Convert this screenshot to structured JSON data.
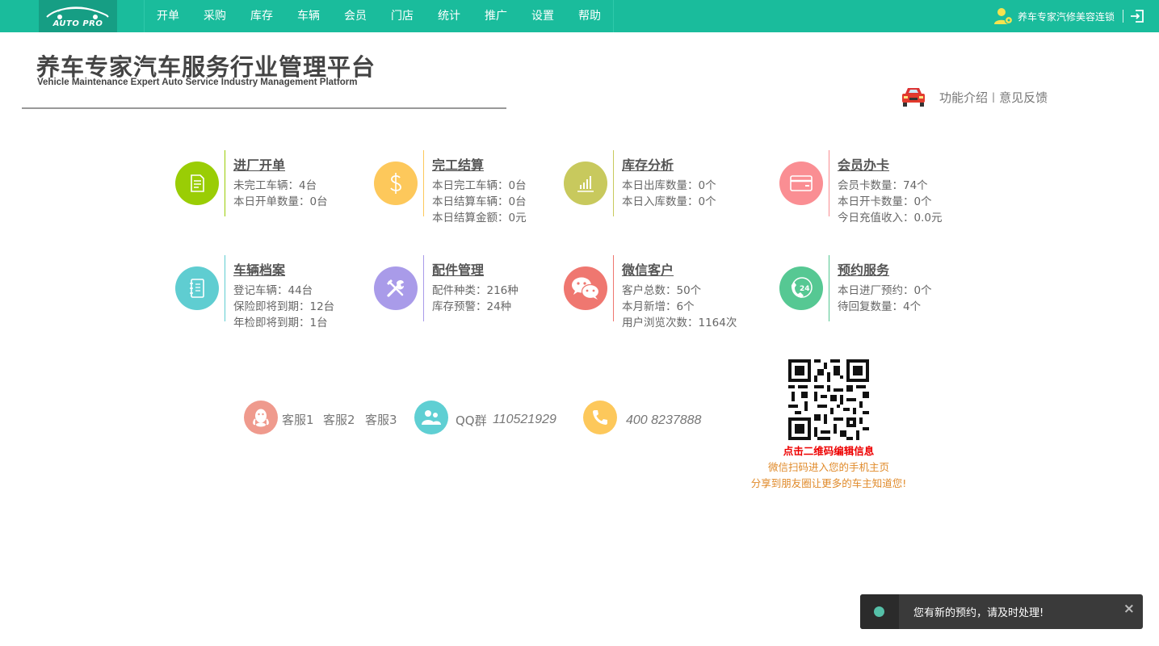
{
  "brand": {
    "logo_text": "AUTO PRO"
  },
  "nav": [
    "开单",
    "采购",
    "库存",
    "车辆",
    "会员",
    "门店",
    "统计",
    "推广",
    "设置",
    "帮助"
  ],
  "user": {
    "name": "养车专家汽修美容连锁"
  },
  "heading": {
    "title": "养车专家汽车服务行业管理平台",
    "subtitle": "Vehicle Maintenance Expert Auto Service Industry Management Platform"
  },
  "links": {
    "intro": "功能介绍",
    "sep": "|",
    "feedback": "意见反馈"
  },
  "cards": [
    {
      "title": "进厂开单",
      "icon": "document-icon",
      "color": "#9acd05",
      "lines": [
        "未完工车辆：4台",
        "本日开单数量：0台"
      ]
    },
    {
      "title": "完工结算",
      "icon": "dollar-icon",
      "color": "#fdc85b",
      "lines": [
        "本日完工车辆：0台",
        "本日结算车辆：0台",
        "本日结算金额：0元"
      ]
    },
    {
      "title": "库存分析",
      "icon": "bar-chart-icon",
      "color": "#c8c95d",
      "lines": [
        "本日出库数量：0个",
        "本日入库数量：0个"
      ]
    },
    {
      "title": "会员办卡",
      "icon": "credit-card-icon",
      "color": "#fa8e93",
      "lines": [
        "会员卡数量：74个",
        "本日开卡数量：0个",
        "今日充值收入：0.0元"
      ]
    },
    {
      "title": "车辆档案",
      "icon": "notebook-icon",
      "color": "#5fcdd1",
      "lines": [
        "登记车辆：44台",
        "保险即将到期：12台",
        "年检即将到期：1台"
      ]
    },
    {
      "title": "配件管理",
      "icon": "tools-icon",
      "color": "#a99be9",
      "lines": [
        "配件种类：216种",
        "库存预警：24种"
      ]
    },
    {
      "title": "微信客户",
      "icon": "wechat-icon",
      "color": "#ef7770",
      "lines": [
        "客户总数：50个",
        "本月新增：6个",
        "用户浏览次数：1164次"
      ]
    },
    {
      "title": "预约服务",
      "icon": "phone-24-icon",
      "color": "#56c893",
      "lines": [
        "本日进厂预约：0个",
        "待回复数量：4个"
      ]
    }
  ],
  "contacts": {
    "service": [
      "客服1",
      "客服2",
      "客服3"
    ],
    "qq_label": "QQ群",
    "qq_number": "110521929",
    "phone": "400 8237888"
  },
  "qr": {
    "title": "点击二维码编辑信息",
    "line1": "微信扫码进入您的手机主页",
    "line2": "分享到朋友圈让更多的车主知道您!"
  },
  "toast": {
    "message": "您有新的预约，请及时处理!",
    "close": "×"
  }
}
